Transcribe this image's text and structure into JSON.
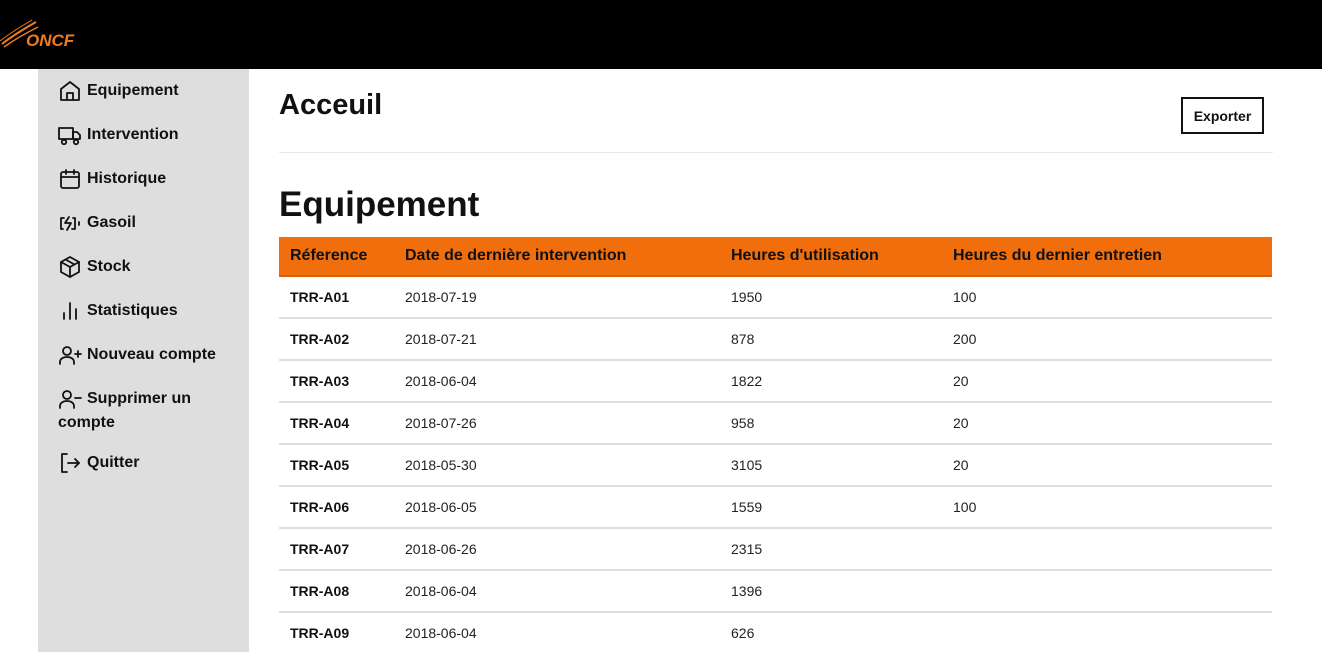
{
  "header": {
    "logo_text": "ONCF"
  },
  "sidebar": {
    "items": [
      {
        "label": "Equipement",
        "icon": "home-icon"
      },
      {
        "label": "Intervention",
        "icon": "truck-icon"
      },
      {
        "label": "Historique",
        "icon": "calendar-icon"
      },
      {
        "label": "Gasoil",
        "icon": "battery-charging-icon"
      },
      {
        "label": "Stock",
        "icon": "box-icon"
      },
      {
        "label": "Statistiques",
        "icon": "bar-chart-icon"
      },
      {
        "label": "Nouveau compte",
        "icon": "user-plus-icon"
      },
      {
        "label": "Supprimer un compte",
        "icon": "user-minus-icon"
      },
      {
        "label": "Quitter",
        "icon": "log-out-icon"
      }
    ]
  },
  "main": {
    "title": "Acceuil",
    "export_label": "Exporter",
    "section_title": "Equipement",
    "table": {
      "columns": [
        "Réference",
        "Date de dernière intervention",
        "Heures d'utilisation",
        "Heures du dernier entretien"
      ],
      "rows": [
        [
          "TRR-A01",
          "2018-07-19",
          "1950",
          "100"
        ],
        [
          "TRR-A02",
          "2018-07-21",
          "878",
          "200"
        ],
        [
          "TRR-A03",
          "2018-06-04",
          "1822",
          "20"
        ],
        [
          "TRR-A04",
          "2018-07-26",
          "958",
          "20"
        ],
        [
          "TRR-A05",
          "2018-05-30",
          "3105",
          "20"
        ],
        [
          "TRR-A06",
          "2018-06-05",
          "1559",
          "100"
        ],
        [
          "TRR-A07",
          "2018-06-26",
          "2315",
          ""
        ],
        [
          "TRR-A08",
          "2018-06-04",
          "1396",
          ""
        ],
        [
          "TRR-A09",
          "2018-06-04",
          "626",
          ""
        ]
      ]
    }
  },
  "colors": {
    "accent": "#f06e0c",
    "logo": "#f07c1c",
    "sidebar_bg": "#dedede",
    "topbar_bg": "#000000"
  }
}
